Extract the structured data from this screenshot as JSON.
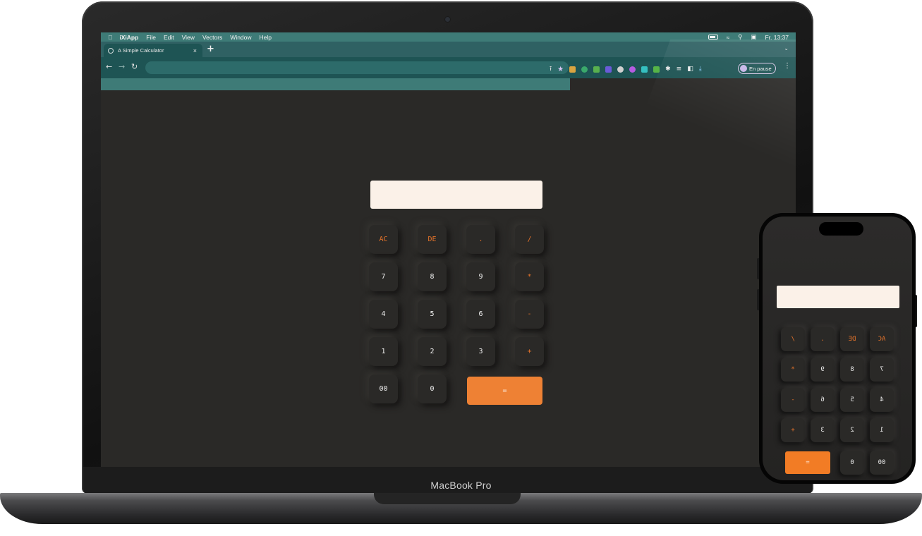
{
  "menubar": {
    "apple_icon": "apple-logo",
    "items": [
      "iXiApp",
      "File",
      "Edit",
      "View",
      "Vectors",
      "Window",
      "Help"
    ],
    "clock": "Fr. 13:37"
  },
  "browser": {
    "tab_title": "A Simple Calculator",
    "tab_close": "×",
    "new_tab": "+",
    "profile_label": "En pause",
    "accent_color": "#3e7b77"
  },
  "calculator": {
    "display_value": "",
    "keys": {
      "ac": "AC",
      "de": "DE",
      "dot": ".",
      "divide": "/",
      "seven": "7",
      "eight": "8",
      "nine": "9",
      "multiply": "*",
      "four": "4",
      "five": "5",
      "six": "6",
      "minus": "-",
      "one": "1",
      "two": "2",
      "three": "3",
      "plus": "+",
      "double_zero": "00",
      "zero": "0",
      "equals": "="
    },
    "operator_color": "#e7742a",
    "equals_color": "#ee8134",
    "background_color": "#2a2927"
  },
  "device": {
    "brand_label": "MacBook Pro"
  }
}
